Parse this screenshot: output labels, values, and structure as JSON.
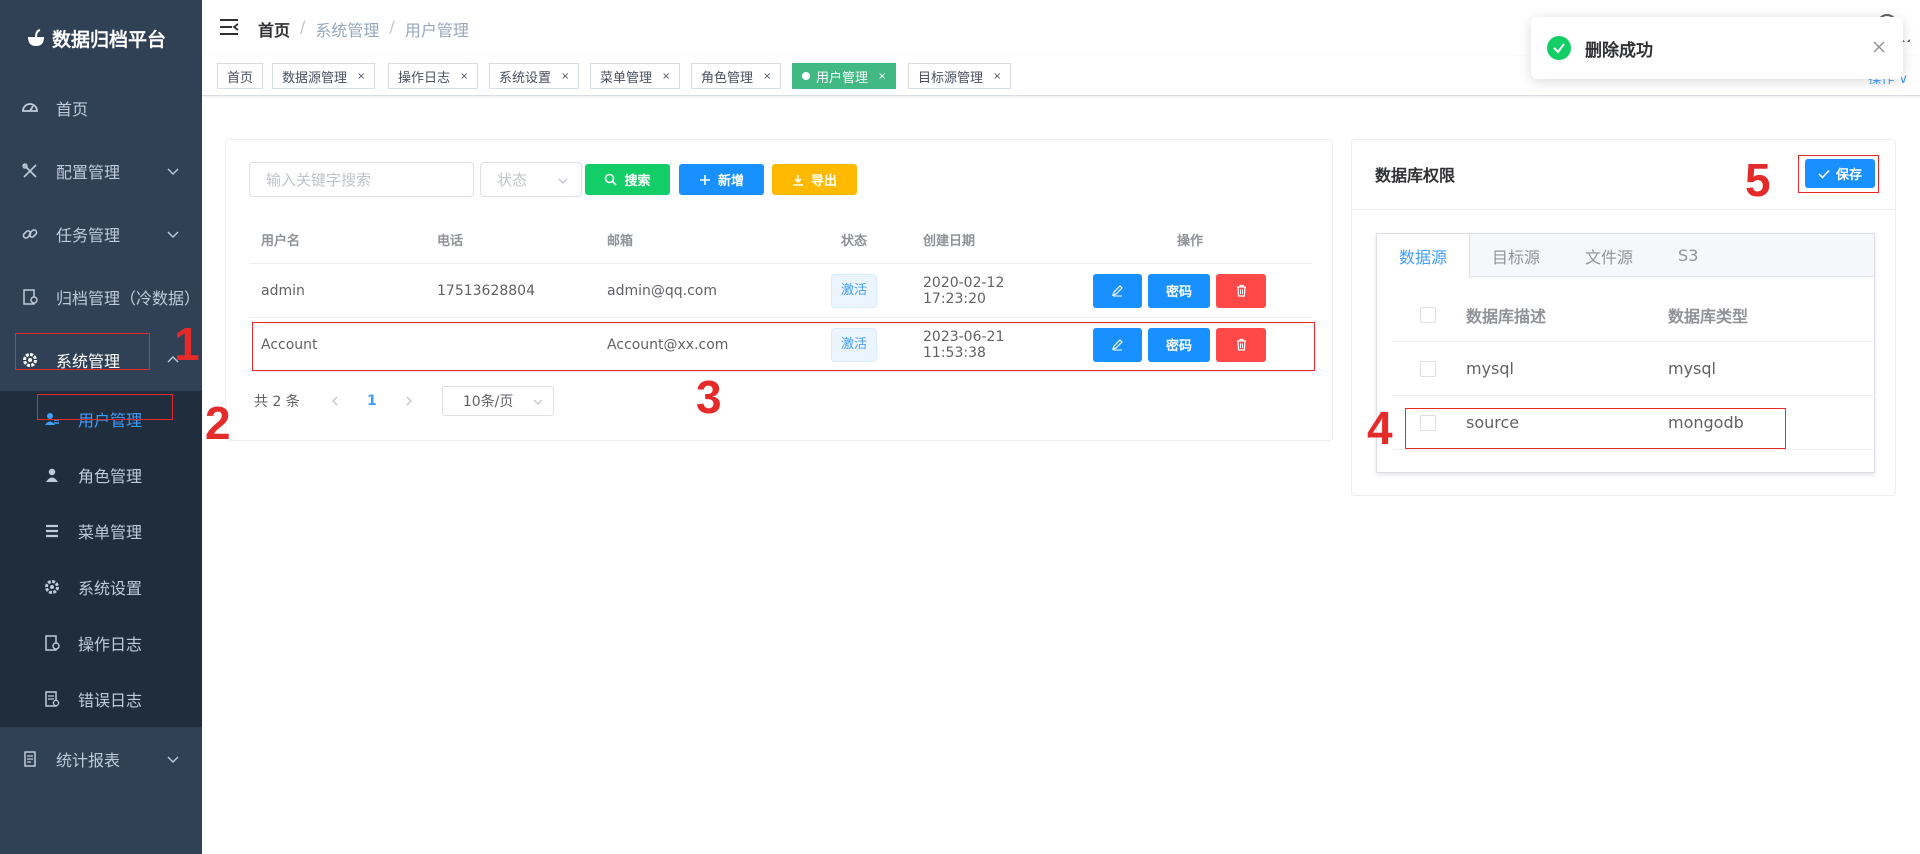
{
  "app": {
    "title": "数据归档平台"
  },
  "sidebar": {
    "items": [
      {
        "label": "首页",
        "icon": "dashboard-icon"
      },
      {
        "label": "配置管理",
        "icon": "tools-icon"
      },
      {
        "label": "任务管理",
        "icon": "link-icon"
      },
      {
        "label": "归档管理（冷数据）",
        "icon": "archive-doc-icon"
      },
      {
        "label": "系统管理",
        "icon": "gear-icon"
      },
      {
        "label": "统计报表",
        "icon": "report-icon"
      }
    ],
    "submenu": [
      {
        "label": "用户管理",
        "icon": "users-icon"
      },
      {
        "label": "角色管理",
        "icon": "role-icon"
      },
      {
        "label": "菜单管理",
        "icon": "menu-list-icon"
      },
      {
        "label": "系统设置",
        "icon": "gear-icon"
      },
      {
        "label": "操作日志",
        "icon": "log-doc-icon"
      },
      {
        "label": "错误日志",
        "icon": "error-log-icon"
      }
    ]
  },
  "breadcrumb": {
    "first": "首页",
    "second": "系统管理",
    "third": "用户管理",
    "sep": "/"
  },
  "tags": {
    "items": [
      "首页",
      "数据源管理",
      "操作日志",
      "系统设置",
      "菜单管理",
      "角色管理",
      "用户管理",
      "目标源管理"
    ],
    "close": "×",
    "ops": "操作 ∨"
  },
  "toolbar": {
    "search_placeholder": "输入关键字搜索",
    "status_placeholder": "状态",
    "search_label": "搜索",
    "add_label": "新增",
    "export_label": "导出"
  },
  "users_table": {
    "headers": {
      "user": "用户名",
      "phone": "电话",
      "email": "邮箱",
      "status": "状态",
      "date": "创建日期",
      "ops": "操作"
    },
    "rows": [
      {
        "user": "admin",
        "phone": "17513628804",
        "email": "admin@qq.com",
        "status": "激活",
        "date": "2020-02-12 17:23:20",
        "pwd": "密码"
      },
      {
        "user": "Account",
        "phone": "",
        "email": "Account@xx.com",
        "status": "激活",
        "date": "2023-06-21 11:53:38",
        "pwd": "密码"
      }
    ]
  },
  "pagination": {
    "total": "共 2 条",
    "current": "1",
    "size": "10条/页"
  },
  "db_permission": {
    "title": "数据库权限",
    "save_label": "保存",
    "tabs": [
      "数据源",
      "目标源",
      "文件源",
      "S3"
    ],
    "headers": {
      "desc": "数据库描述",
      "type": "数据库类型"
    },
    "rows": [
      {
        "desc": "mysql",
        "type": "mysql"
      },
      {
        "desc": "source",
        "type": "mongodb"
      }
    ]
  },
  "toast": {
    "message": "删除成功"
  },
  "annotations": [
    "1",
    "2",
    "3",
    "4",
    "5"
  ],
  "colors": {
    "sidebar_bg": "#304156",
    "submenu_bg": "#1f2d3d",
    "accent": "#409eff",
    "primary_btn": "#1890ff",
    "success_btn": "#13ce66",
    "warning_btn": "#ffba00",
    "danger_btn": "#ff4949",
    "active_tag": "#42b983",
    "annotation_red": "#e52a2a"
  }
}
